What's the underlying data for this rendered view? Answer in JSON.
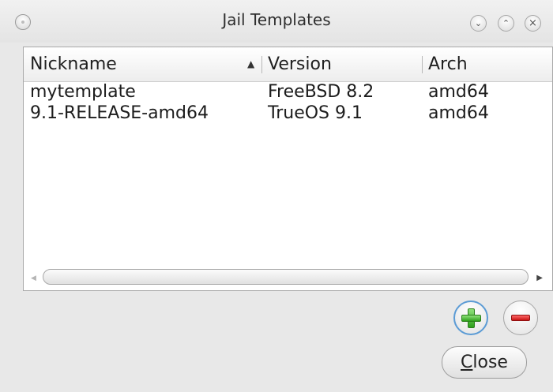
{
  "window": {
    "title": "Jail Templates"
  },
  "table": {
    "columns": {
      "nickname": "Nickname",
      "version": "Version",
      "arch": "Arch"
    },
    "sort_indicator": "▲",
    "rows": [
      {
        "nickname": "mytemplate",
        "version": "FreeBSD 8.2",
        "arch": "amd64"
      },
      {
        "nickname": "9.1-RELEASE-amd64",
        "version": "TrueOS 9.1",
        "arch": "amd64"
      }
    ]
  },
  "buttons": {
    "close_mnemonic": "C",
    "close_rest": "lose"
  },
  "icons": {
    "titlebar_menu": "window-menu-icon",
    "minimize": "chevron-down-icon",
    "maximize": "chevron-up-icon",
    "close": "close-icon",
    "add": "plus-icon",
    "remove": "minus-icon"
  },
  "colors": {
    "add_accent": "#2fa01c",
    "remove_accent": "#c91313",
    "focus_ring": "#5b9bd5"
  }
}
